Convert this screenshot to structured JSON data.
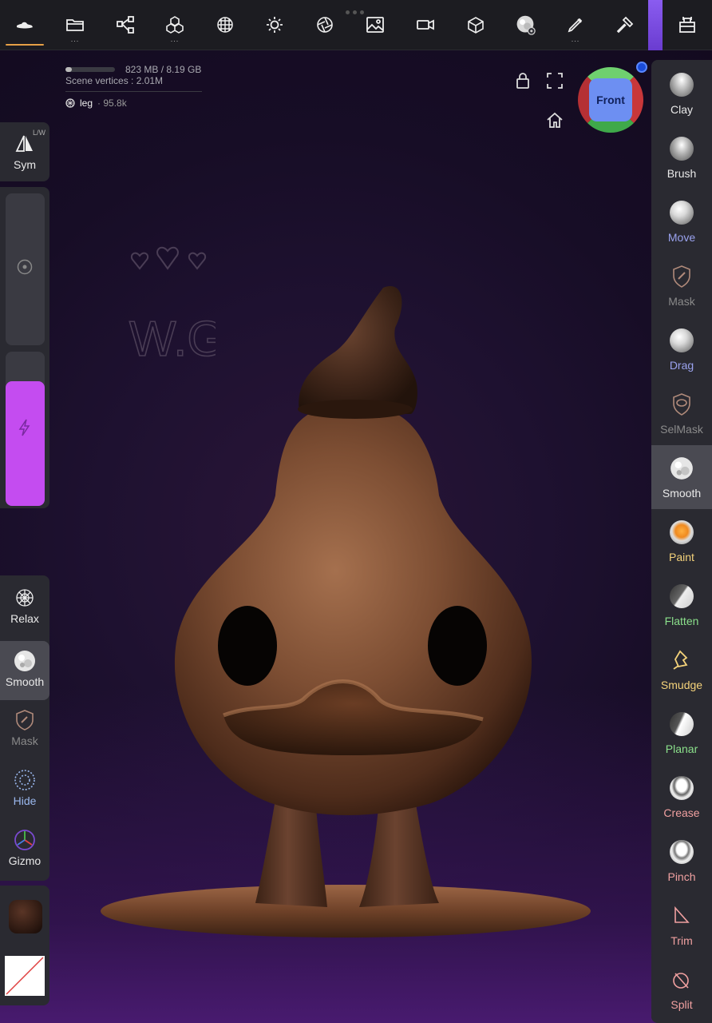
{
  "topbar": {
    "items": [
      {
        "name": "hat-menu-icon",
        "dots": ""
      },
      {
        "name": "folder-icon",
        "dots": "..."
      },
      {
        "name": "scene-graph-icon",
        "dots": ""
      },
      {
        "name": "multires-cubes-icon",
        "dots": "..."
      },
      {
        "name": "topology-sphere-icon",
        "dots": ""
      },
      {
        "name": "light-sun-icon",
        "dots": ""
      },
      {
        "name": "material-aperture-icon",
        "dots": ""
      },
      {
        "name": "image-icon",
        "dots": ""
      },
      {
        "name": "camera-icon",
        "dots": ""
      },
      {
        "name": "box-icon",
        "dots": ""
      },
      {
        "name": "brush-settings-icon",
        "dots": ""
      },
      {
        "name": "pen-icon",
        "dots": "..."
      },
      {
        "name": "hammer-icon",
        "dots": ""
      },
      {
        "name": "toolbox-icon",
        "dots": ""
      }
    ]
  },
  "stats": {
    "memory": "823 MB / 8.19 GB",
    "memory_fraction": 0.1,
    "vertices": "Scene vertices : 2.01M",
    "mesh_name": "leg",
    "mesh_count": "· 95.8k"
  },
  "gizmo": {
    "face_label": "Front"
  },
  "left": {
    "sym_label": "Sym",
    "sym_badge": "L/W",
    "tools": [
      {
        "key": "relax",
        "label": "Relax"
      },
      {
        "key": "smooth",
        "label": "Smooth"
      },
      {
        "key": "mask",
        "label": "Mask"
      },
      {
        "key": "hide",
        "label": "Hide"
      },
      {
        "key": "gizmo",
        "label": "Gizmo"
      }
    ]
  },
  "right_tools": [
    {
      "label": "Clay",
      "color": "#e9e9e9"
    },
    {
      "label": "Brush",
      "color": "#e9e9e9"
    },
    {
      "label": "Move",
      "color": "#9aa2ee"
    },
    {
      "label": "Mask",
      "color": "#8a8a8a"
    },
    {
      "label": "Drag",
      "color": "#9aa2ee"
    },
    {
      "label": "SelMask",
      "color": "#8a8a8a"
    },
    {
      "label": "Smooth",
      "color": "#e9e9e9"
    },
    {
      "label": "Paint",
      "color": "#f4d27a"
    },
    {
      "label": "Flatten",
      "color": "#8be08b"
    },
    {
      "label": "Smudge",
      "color": "#f4d27a"
    },
    {
      "label": "Planar",
      "color": "#8be08b"
    },
    {
      "label": "Crease",
      "color": "#f0a0a0"
    },
    {
      "label": "Pinch",
      "color": "#f0a0a0"
    },
    {
      "label": "Trim",
      "color": "#f0a0a0"
    },
    {
      "label": "Split",
      "color": "#f0a0a0"
    }
  ],
  "canvas": {
    "watermark": "W.G"
  },
  "colors": {
    "accent": "#e6a046",
    "slider": "#c44cf0",
    "selected": "#4a4a52",
    "panel": "#2a2a31"
  }
}
